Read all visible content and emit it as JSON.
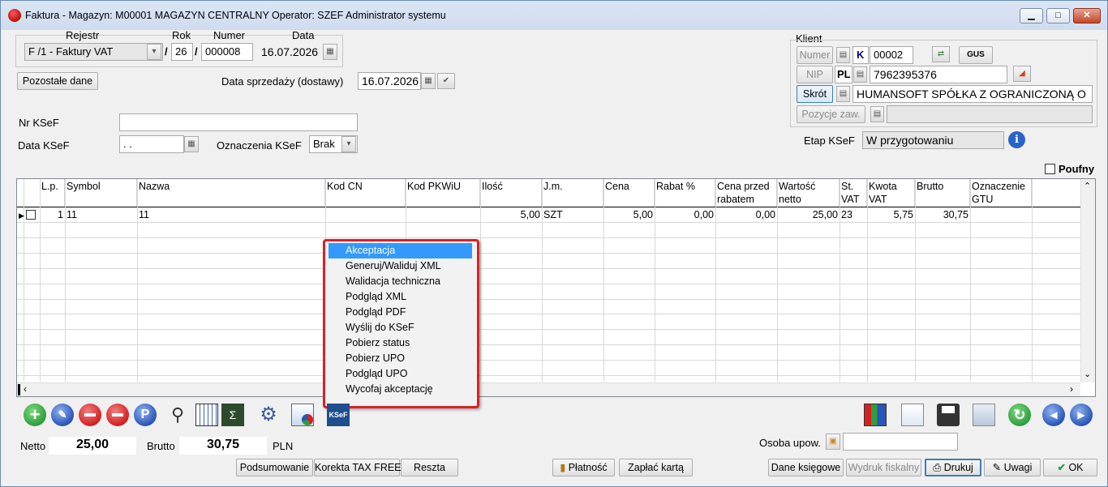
{
  "window": {
    "title": "Faktura - Magazyn: M00001 MAGAZYN CENTRALNY  Operator: SZEF Administrator systemu",
    "minimize": "▁",
    "maximize": "□",
    "close": "✕"
  },
  "header": {
    "rejestr_label": "Rejestr",
    "rok_label": "Rok",
    "numer_label": "Numer",
    "data_label": "Data",
    "rejestr_value": "F /1   - Faktury VAT",
    "rok_value": "26",
    "numer_value": "000008",
    "data_value": "16.07.2026",
    "slash": "/",
    "pozostale_button": "Pozostałe dane",
    "data_sprzedazy_label": "Data sprzedaży (dostawy)",
    "data_sprzedazy_value": "16.07.2026"
  },
  "ksef": {
    "nr_label": "Nr KSeF",
    "nr_value": "",
    "data_label": "Data KSeF",
    "data_value": " . .",
    "oznaczenia_label": "Oznaczenia KSeF",
    "oznaczenia_value": "Brak",
    "etap_label": "Etap KSeF",
    "etap_value": "W przygotowaniu"
  },
  "klient": {
    "section_label": "Klient",
    "numer_button": "Numer",
    "nip_button": "NIP",
    "skrot_button": "Skrót",
    "pozycje_button": "Pozycje zaw.",
    "type_code": "K",
    "numer_value": "00002",
    "gus_label": "GUS",
    "country": "PL",
    "nip_value": "7962395376",
    "skrot_value": "HUMANSOFT SPÓŁKA Z OGRANICZONĄ O",
    "pozycje_value": ""
  },
  "poufny_label": "Poufny",
  "grid": {
    "headers": [
      "L.p.",
      "Symbol",
      "Nazwa",
      "Kod  CN",
      "Kod  PKWiU",
      "Ilość",
      "J.m.",
      "Cena",
      "Rabat %",
      "Cena przed rabatem",
      "Wartość netto",
      "St. VAT",
      "Kwota VAT",
      "Brutto",
      "Oznaczenie GTU"
    ],
    "rows": [
      {
        "lp": "1",
        "symbol": "11",
        "nazwa": "11",
        "kod_cn": "",
        "kod_pkwiu": "",
        "ilosc": "5,00",
        "jm": "SZT",
        "cena": "5,00",
        "rabat": "0,00",
        "cena_przed": "0,00",
        "wartosc": "25,00",
        "st_vat": "23",
        "kwota_vat": "5,75",
        "brutto": "30,75",
        "gtu": ""
      }
    ]
  },
  "context_menu": {
    "items": [
      "Akceptacja",
      "Generuj/Waliduj XML",
      "Walidacja techniczna",
      "Podgląd XML",
      "Podgląd PDF",
      "Wyślij do KSeF",
      "Pobierz status",
      "Pobierz UPO",
      "Podgląd UPO",
      "Wycofaj akceptację"
    ],
    "selected": "Akceptacja"
  },
  "totals": {
    "netto_label": "Netto",
    "netto_value": "25,00",
    "brutto_label": "Brutto",
    "brutto_value": "30,75",
    "currency": "PLN",
    "osoba_label": "Osoba upow.",
    "osoba_value": ""
  },
  "buttons": {
    "podsumowanie": "Podsumowanie",
    "korekta": "Korekta TAX FREE",
    "reszta": "Reszta",
    "platnosc": "Płatność",
    "zaplac": "Zapłać kartą",
    "dane_ksiegowe": "Dane księgowe",
    "wydruk": "Wydruk fiskalny",
    "drukuj": "Drukuj",
    "uwagi": "Uwagi",
    "ok": "OK"
  },
  "toolbar_ksef_label": "KSeF",
  "colors": {
    "menu_border": "#d9202a",
    "menu_selected": "#3399ff",
    "add_green": "#2e9e3e",
    "delete_red": "#d42020",
    "info_blue": "#2a64c8"
  }
}
